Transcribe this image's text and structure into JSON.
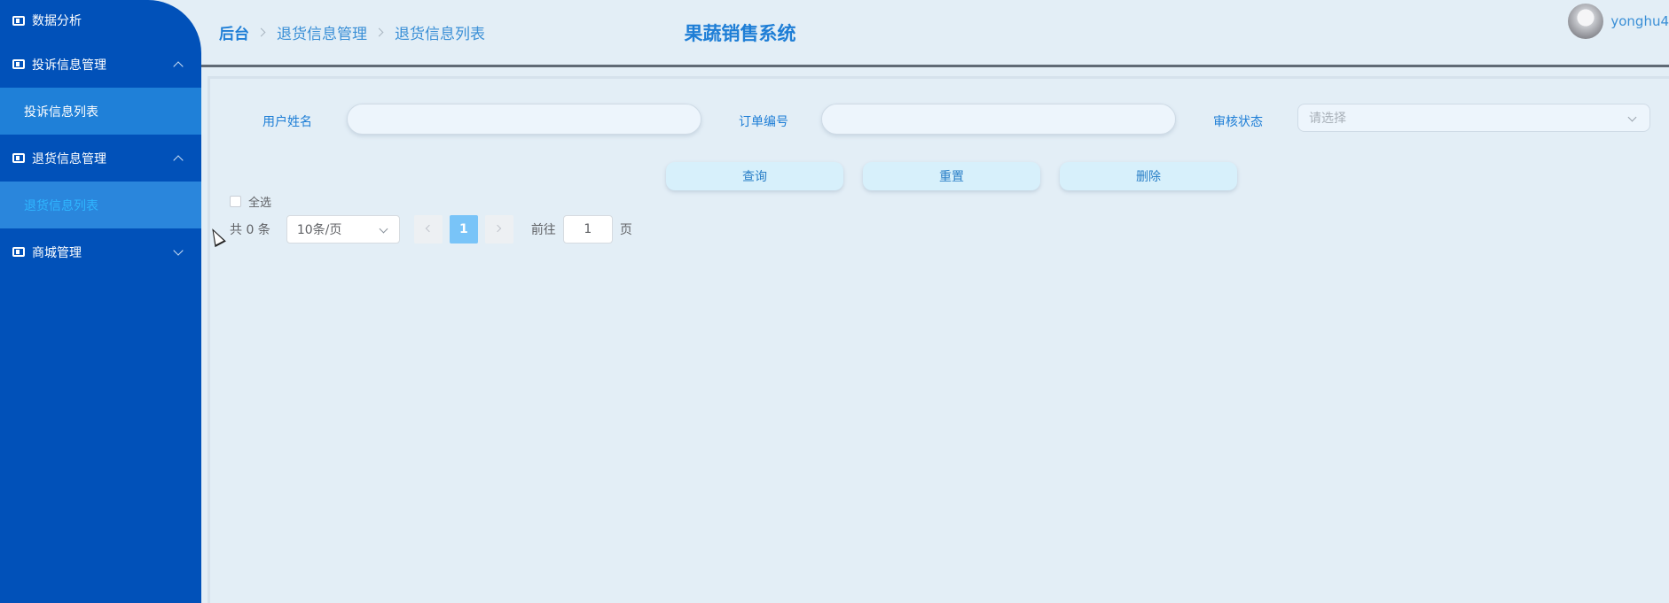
{
  "sidebar": {
    "items": [
      {
        "label": "数据分析"
      },
      {
        "label": "投诉信息管理"
      },
      {
        "label": "投诉信息列表"
      },
      {
        "label": "退货信息管理"
      },
      {
        "label": "退货信息列表"
      },
      {
        "label": "商城管理"
      }
    ]
  },
  "header": {
    "breadcrumb": [
      "后台",
      "退货信息管理",
      "退货信息列表"
    ],
    "title": "果蔬销售系统",
    "username": "yonghu4"
  },
  "search": {
    "username_label": "用户姓名",
    "username_value": "",
    "order_label": "订单编号",
    "order_value": "",
    "status_label": "审核状态",
    "status_placeholder": "请选择"
  },
  "actions": {
    "query": "查询",
    "reset": "重置",
    "delete": "删除"
  },
  "table": {
    "select_all": "全选"
  },
  "pagination": {
    "total": "共 0 条",
    "page_size": "10条/页",
    "current_page": "1",
    "goto_label": "前往",
    "goto_value": "1",
    "page_suffix": "页"
  }
}
